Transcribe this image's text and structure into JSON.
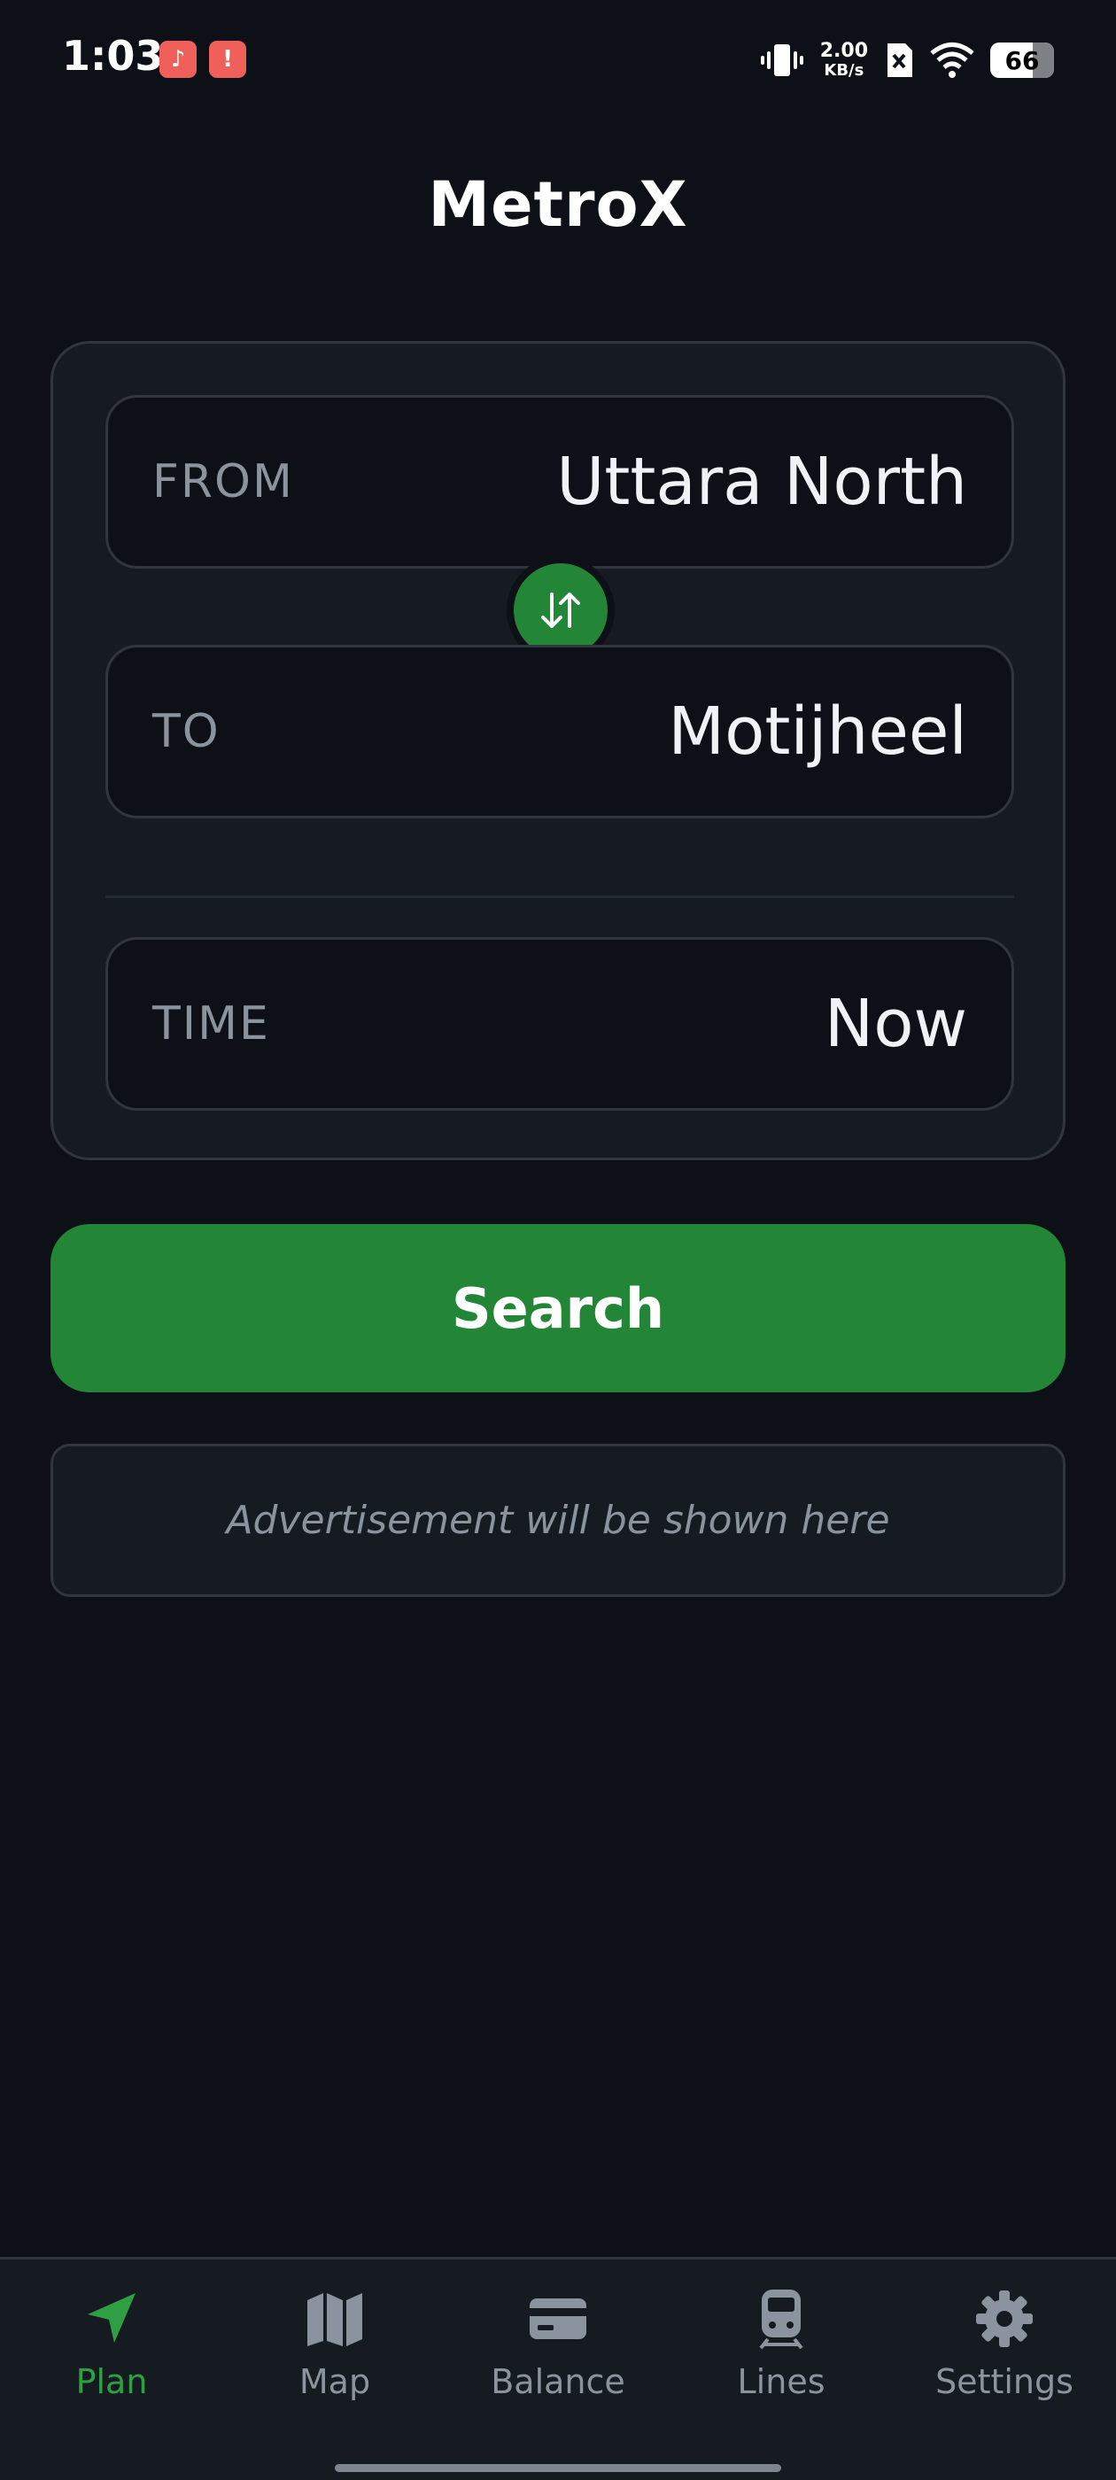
{
  "status_bar": {
    "time": "1:03",
    "net_speed_value": "2.00",
    "net_speed_unit": "KB/s",
    "battery": "66",
    "icons": [
      "music-app-icon",
      "warning-icon",
      "vibrate-icon",
      "sim-icon",
      "wifi-icon",
      "battery-icon"
    ]
  },
  "app": {
    "title": "MetroX"
  },
  "planner": {
    "from": {
      "label": "FROM",
      "value": "Uttara North"
    },
    "to": {
      "label": "TO",
      "value": "Motijheel"
    },
    "time": {
      "label": "TIME",
      "value": "Now"
    },
    "swap_icon": "swap-vertical-icon"
  },
  "search": {
    "label": "Search"
  },
  "ad": {
    "text": "Advertisement will be shown here"
  },
  "nav": {
    "items": [
      {
        "label": "Plan",
        "icon": "navigation-arrow-icon",
        "active": true
      },
      {
        "label": "Map",
        "icon": "map-icon",
        "active": false
      },
      {
        "label": "Balance",
        "icon": "card-icon",
        "active": false
      },
      {
        "label": "Lines",
        "icon": "train-icon",
        "active": false
      },
      {
        "label": "Settings",
        "icon": "gear-icon",
        "active": false
      }
    ]
  },
  "colors": {
    "background": "#0d1117",
    "card": "#161b22",
    "border": "#30363d",
    "accent": "#238636",
    "active_nav": "#2ea043",
    "muted_text": "#8b949e"
  }
}
